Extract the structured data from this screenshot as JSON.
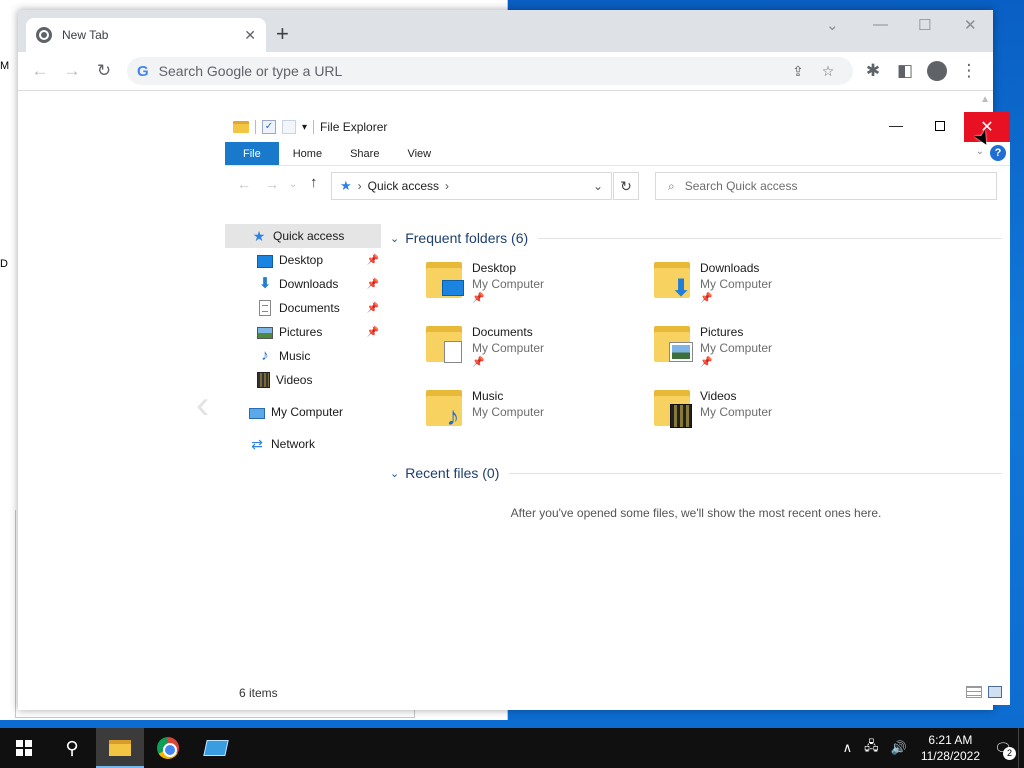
{
  "desktop": {
    "fragments": [
      "M",
      "D"
    ]
  },
  "chrome": {
    "tab_title": "New Tab",
    "tab_close": "✕",
    "new_tab": "+",
    "minimize": "—",
    "maximize": "☐",
    "close": "✕",
    "tab_search": "⌄",
    "back": "←",
    "forward": "→",
    "reload": "↻",
    "google_g": "G",
    "omnibox_placeholder": "Search Google or type a URL",
    "share_icon": "⇪",
    "bookmark_icon": "☆",
    "extensions_icon": "✱",
    "sidepanel_icon": "◧",
    "menu_icon": "⋮"
  },
  "explorer": {
    "title": "File Explorer",
    "qat_dropdown": "▾",
    "minimize": "—",
    "close": "✕",
    "ribbon": {
      "tabs": [
        "File",
        "Home",
        "Share",
        "View"
      ],
      "help": "?",
      "expand": "⌄"
    },
    "nav_back": "←",
    "nav_forward": "→",
    "recent_dd": "⌄",
    "nav_up": "↑",
    "address": {
      "star": "★",
      "sep": "›",
      "location": "Quick access",
      "arrow": "›",
      "dropdown": "⌄"
    },
    "refresh": "↻",
    "search": {
      "icon": "⌕",
      "placeholder": "Search Quick access"
    },
    "nav_pane": {
      "quick_access": "Quick access",
      "desktop": "Desktop",
      "downloads": "Downloads",
      "documents": "Documents",
      "pictures": "Pictures",
      "music": "Music",
      "videos": "Videos",
      "my_computer": "My Computer",
      "network": "Network",
      "pin": "📌",
      "icons": {
        "star": "★",
        "download": "⬇",
        "music": "♪",
        "network": "⇄"
      }
    },
    "frequent": {
      "chevron": "⌄",
      "header": "Frequent folders (6)",
      "pin": "📌",
      "music_badge": "♪",
      "download_badge": "⬇",
      "folders": [
        {
          "name": "Desktop",
          "location": "My Computer"
        },
        {
          "name": "Downloads",
          "location": "My Computer"
        },
        {
          "name": "Documents",
          "location": "My Computer"
        },
        {
          "name": "Pictures",
          "location": "My Computer"
        },
        {
          "name": "Music",
          "location": "My Computer"
        },
        {
          "name": "Videos",
          "location": "My Computer"
        }
      ]
    },
    "recent": {
      "chevron": "⌄",
      "header": "Recent files (0)",
      "empty_message": "After you've opened some files, we'll show the most recent ones here."
    },
    "status": "6 items",
    "scroll_up": "▲"
  },
  "taskbar": {
    "search_icon": "⚲",
    "tray_chevron": "∧",
    "network_icon": "🖧",
    "volume_icon": "🔊",
    "time": "6:21 AM",
    "date": "11/28/2022",
    "notif_icon": "🗨",
    "notifications": "2"
  },
  "cursor": "➤"
}
